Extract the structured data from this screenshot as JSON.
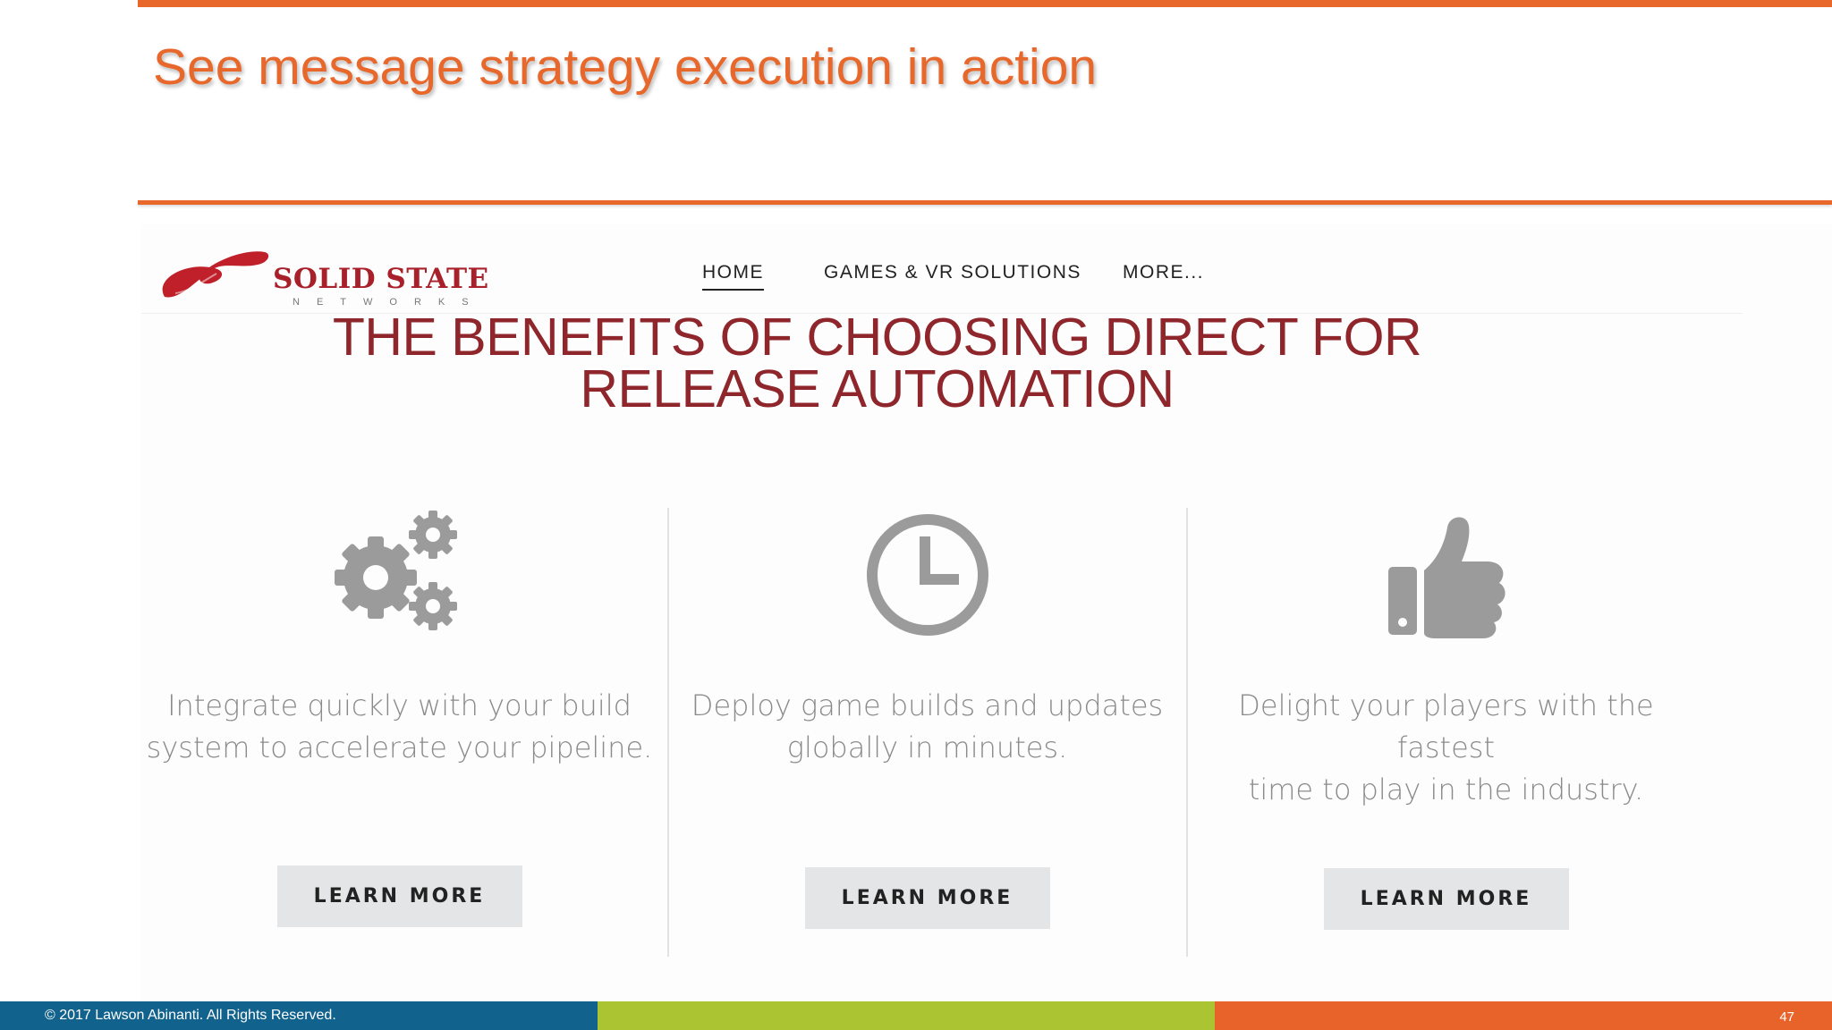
{
  "slide": {
    "title": "See message strategy execution in action",
    "footer_copyright": "© 2017 Lawson Abinanti. All Rights Reserved.",
    "page_number": "47",
    "accent_color": "#e8672a",
    "footer_colors": [
      "#11628d",
      "#aac432",
      "#e8632a"
    ]
  },
  "site": {
    "logo": {
      "wordmark": "SOLID STATE",
      "subtitle": "NETWORKS",
      "color": "#a8202a"
    },
    "nav": {
      "items": [
        {
          "label": "HOME",
          "active": true
        },
        {
          "label": "GAMES & VR SOLUTIONS"
        },
        {
          "label": "MORE..."
        }
      ]
    },
    "headline": {
      "line1": "THE BENEFITS OF CHOOSING DIRECT FOR",
      "line2": "RELEASE AUTOMATION",
      "color": "#8e262b"
    },
    "features": [
      {
        "icon": "gears-icon",
        "line1": "Integrate quickly with your build",
        "line2": "system to accelerate your pipeline.",
        "button": "LEARN MORE"
      },
      {
        "icon": "clock-icon",
        "line1": "Deploy game builds and updates",
        "line2": "globally in minutes.",
        "button": "LEARN MORE"
      },
      {
        "icon": "thumbs-up-icon",
        "line1": "Delight your players with the fastest",
        "line2": "time to play in the industry.",
        "button": "LEARN MORE"
      }
    ]
  }
}
